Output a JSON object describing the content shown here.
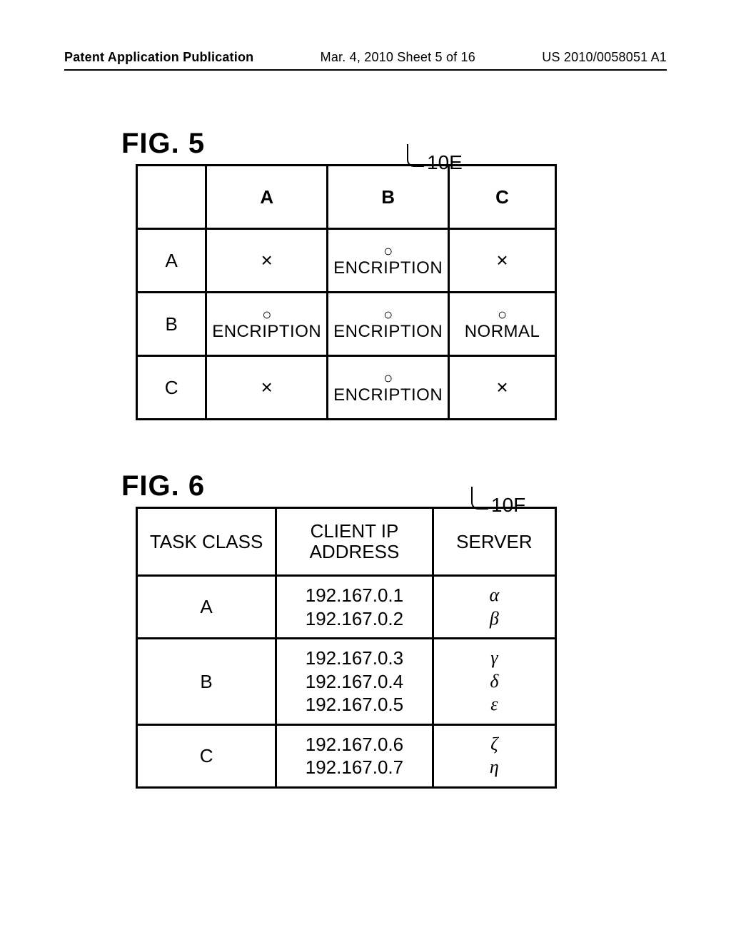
{
  "header": {
    "left": "Patent Application Publication",
    "center": "Mar. 4, 2010  Sheet 5 of 16",
    "right": "US 2010/0058051 A1"
  },
  "fig5": {
    "label": "FIG. 5",
    "ref": "10E",
    "col_headers": [
      "",
      "A",
      "B",
      "C"
    ],
    "rows": [
      {
        "head": "A",
        "cells": [
          {
            "type": "cross",
            "mark": "×"
          },
          {
            "type": "enc",
            "mark": "○",
            "text": "ENCRIPTION"
          },
          {
            "type": "cross",
            "mark": "×"
          }
        ]
      },
      {
        "head": "B",
        "cells": [
          {
            "type": "enc",
            "mark": "○",
            "text": "ENCRIPTION"
          },
          {
            "type": "enc",
            "mark": "○",
            "text": "ENCRIPTION"
          },
          {
            "type": "enc",
            "mark": "○",
            "text": "NORMAL"
          }
        ]
      },
      {
        "head": "C",
        "cells": [
          {
            "type": "cross",
            "mark": "×"
          },
          {
            "type": "enc",
            "mark": "○",
            "text": "ENCRIPTION"
          },
          {
            "type": "cross",
            "mark": "×"
          }
        ]
      }
    ]
  },
  "fig6": {
    "label": "FIG. 6",
    "ref": "10F",
    "headers": {
      "task_class": "TASK CLASS",
      "client_ip": "CLIENT IP\nADDRESS",
      "server": "SERVER"
    },
    "rows": [
      {
        "task_class": "A",
        "client_ip": "192.167.0.1\n192.167.0.2",
        "server": "α\nβ"
      },
      {
        "task_class": "B",
        "client_ip": "192.167.0.3\n192.167.0.4\n192.167.0.5",
        "server": "γ\nδ\nε"
      },
      {
        "task_class": "C",
        "client_ip": "192.167.0.6\n192.167.0.7",
        "server": "ζ\nη"
      }
    ]
  }
}
